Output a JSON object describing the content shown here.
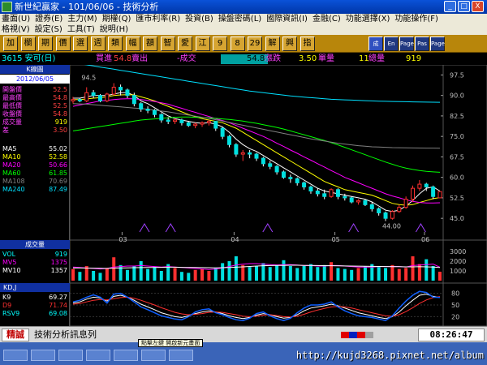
{
  "window": {
    "title": "新世紀贏家 - 101/06/06 - 技術分析",
    "min": "_",
    "max": "□",
    "close": "X"
  },
  "menu": {
    "row1": [
      "畫面(U)",
      "證券(E)",
      "主力(M)",
      "期權(Q)",
      "匯市利率(R)",
      "投資(B)",
      "操盤密碼(L)",
      "國際資訊(I)",
      "金融(C)",
      "功能選擇(X)",
      "功能操作(F)"
    ],
    "row2": [
      "格視(V)",
      "設定(S)",
      "工具(T)",
      "說明(H)"
    ]
  },
  "toolbar": {
    "buttons": [
      "加",
      "欄",
      "期",
      "價",
      "選",
      "週",
      "類",
      "幅",
      "額",
      "智",
      "愛",
      "江",
      "9",
      "8",
      "29",
      "解",
      "興",
      "指",
      "成",
      "En",
      "Page",
      "Pas",
      "Page"
    ]
  },
  "quote": {
    "code_label": "3615 安可(日)",
    "buy_label": "買進",
    "buy_value": "54.8",
    "sell_label": "賣出",
    "trade_label": "-成交",
    "trade_value": "54.8",
    "change_label": "漲跌",
    "change_value": "3.50",
    "unit_label": "單量",
    "unit_value": "11",
    "volume_label": "總量",
    "volume_value": "919"
  },
  "kline": {
    "title": "K線圖",
    "date": "2012/06/05",
    "stats": [
      {
        "label": "開盤價",
        "value": "52.5"
      },
      {
        "label": "最高價",
        "value": "54.8"
      },
      {
        "label": "最低價",
        "value": "52.5"
      },
      {
        "label": "收盤價",
        "value": "54.8"
      },
      {
        "label": "成交量",
        "value": "919"
      },
      {
        "label": "差",
        "value": "3.50"
      }
    ],
    "ma": [
      {
        "label": "MA5",
        "value": "55.02",
        "color": "#ffffff"
      },
      {
        "label": "MA10",
        "value": "52.58",
        "color": "#ffff00"
      },
      {
        "label": "MA20",
        "value": "50.66",
        "color": "#ff00ff"
      },
      {
        "label": "MA60",
        "value": "61.85",
        "color": "#00ff00"
      },
      {
        "label": "MA108",
        "value": "70.69",
        "color": "#808080"
      },
      {
        "label": "MA240",
        "value": "87.49",
        "color": "#00e0ff"
      }
    ]
  },
  "volume": {
    "title": "成交量",
    "items": [
      {
        "label": "VOL",
        "value": "919",
        "color": "#00ffff"
      },
      {
        "label": "MV5",
        "value": "1375",
        "color": "#ff00ff"
      },
      {
        "label": "MV10",
        "value": "1357",
        "color": "#ffffff"
      }
    ]
  },
  "kd": {
    "title": "KD,J",
    "items": [
      {
        "label": "K9",
        "value": "69.27",
        "color": "#ffffff"
      },
      {
        "label": "D9",
        "value": "71.74",
        "color": "#ff3030"
      },
      {
        "label": "RSV9",
        "value": "69.08",
        "color": "#00ffff"
      }
    ]
  },
  "status": {
    "brand": "精誠",
    "message": "技術分析訊息列",
    "clock": "08:26:47"
  },
  "taskbar": {
    "watermark": "http://kujd3268.pixnet.net/album",
    "tip": "點擊左鍵 開啟新元畫面"
  },
  "chart_data": [
    {
      "type": "candlestick",
      "y_ticks": [
        "97.5",
        "90.0",
        "82.5",
        "75.0",
        "67.5",
        "60.0",
        "52.5",
        "45.0"
      ],
      "x_labels": [
        "03",
        "04",
        "05",
        "06"
      ],
      "annotations": [
        "94.5",
        "44.00"
      ],
      "ohlc": [
        [
          88,
          89.5,
          87,
          88.5
        ],
        [
          88.5,
          89,
          87.5,
          88
        ],
        [
          88,
          93,
          87.5,
          91
        ],
        [
          91,
          92,
          89,
          90
        ],
        [
          90,
          90.5,
          87.5,
          88
        ],
        [
          88,
          91,
          87.5,
          90.5
        ],
        [
          90.5,
          94.5,
          90,
          93
        ],
        [
          93,
          94,
          90,
          92
        ],
        [
          92,
          92.5,
          89,
          90
        ],
        [
          90,
          91,
          86,
          87
        ],
        [
          87,
          87.5,
          84,
          85
        ],
        [
          85,
          86,
          83.5,
          84.5
        ],
        [
          84.5,
          85,
          82,
          83
        ],
        [
          83,
          83.5,
          80,
          81
        ],
        [
          81,
          82,
          79.5,
          80.5
        ],
        [
          80.5,
          81.5,
          79.5,
          81
        ],
        [
          81,
          81.5,
          79,
          80
        ],
        [
          80,
          80.5,
          78.5,
          79
        ],
        [
          79,
          80,
          78,
          79.5
        ],
        [
          79.5,
          80.5,
          78.5,
          80
        ],
        [
          80,
          81,
          79,
          80.5
        ],
        [
          80.5,
          80.5,
          77,
          78
        ],
        [
          78,
          78.5,
          74,
          75
        ],
        [
          75,
          75.5,
          71,
          72
        ],
        [
          72,
          72.5,
          67.5,
          68.5
        ],
        [
          68.5,
          70,
          66,
          69
        ],
        [
          69,
          70,
          67,
          68.5
        ],
        [
          68.5,
          69,
          66,
          67
        ],
        [
          67,
          67.5,
          64,
          65
        ],
        [
          65,
          66,
          63,
          64
        ],
        [
          64,
          64.5,
          61,
          62
        ],
        [
          62,
          62.5,
          59.5,
          60
        ],
        [
          60,
          61,
          58,
          59.5
        ],
        [
          59.5,
          60,
          57,
          58
        ],
        [
          58,
          58.5,
          55.5,
          56.5
        ],
        [
          56.5,
          57,
          54,
          55
        ],
        [
          55,
          56,
          53,
          54
        ],
        [
          54,
          55.5,
          52,
          53
        ],
        [
          53,
          56,
          52.5,
          55.5
        ],
        [
          55.5,
          56,
          52,
          53
        ],
        [
          53,
          54,
          51.5,
          52.5
        ],
        [
          52.5,
          53,
          50.5,
          51
        ],
        [
          51,
          52,
          50,
          51.5
        ],
        [
          51.5,
          52,
          49.5,
          50
        ],
        [
          50,
          51,
          47.5,
          48.5
        ],
        [
          48.5,
          49,
          46,
          47
        ],
        [
          47,
          47.5,
          44,
          45
        ],
        [
          45,
          48,
          44.5,
          47.5
        ],
        [
          47.5,
          50,
          47,
          49
        ],
        [
          49,
          53,
          48.5,
          52
        ],
        [
          52,
          57,
          51,
          56
        ],
        [
          56,
          59,
          55,
          57.5
        ],
        [
          57.5,
          58,
          55,
          56.5
        ],
        [
          56.5,
          57,
          52,
          53
        ],
        [
          52.5,
          54.8,
          52.5,
          54.8
        ]
      ],
      "ma": {
        "MA5": [
          89,
          89,
          89.5,
          90,
          90,
          90,
          90.5,
          91,
          91,
          90,
          88,
          87,
          85.5,
          84,
          82.5,
          81.5,
          81,
          80.5,
          80,
          79.8,
          80,
          79.5,
          78.5,
          76.5,
          74,
          72,
          70.5,
          69.5,
          68,
          66.5,
          65,
          63.5,
          62,
          60.5,
          59,
          57.5,
          56,
          55,
          54.5,
          54,
          53.5,
          53,
          52.5,
          52,
          51,
          49.5,
          48,
          47.5,
          48,
          49.5,
          51.5,
          54,
          56,
          56.5,
          55
        ],
        "MA10": [
          88.5,
          88.5,
          88.7,
          89,
          89.2,
          89.5,
          90,
          90.2,
          90.3,
          90.2,
          89.5,
          88.8,
          88,
          87,
          86,
          85,
          84,
          83,
          82.2,
          81.5,
          81,
          80.5,
          80,
          79,
          78,
          76.5,
          75,
          73.5,
          72,
          70.5,
          69,
          67.5,
          66,
          64.5,
          63,
          61.5,
          60,
          58.5,
          57.5,
          56.5,
          55.5,
          55,
          54.5,
          54,
          53.5,
          52.5,
          51.5,
          50.5,
          50,
          49.8,
          50,
          50.8,
          51.5,
          52.2,
          52.6
        ],
        "MA20": [
          86,
          86.5,
          87,
          87.5,
          88,
          88.2,
          88.5,
          88.7,
          88.8,
          88.8,
          88.5,
          88.2,
          87.8,
          87.3,
          86.8,
          86,
          85.3,
          84.5,
          83.8,
          83,
          82.3,
          81.5,
          80.8,
          80,
          79,
          78,
          77,
          76,
          75,
          73.8,
          72.5,
          71.3,
          70,
          68.8,
          67.5,
          66.3,
          65,
          63.8,
          62.5,
          61.3,
          60,
          59,
          58,
          57,
          56,
          55,
          54,
          53.2,
          52.5,
          51.8,
          51.2,
          50.8,
          50.6,
          50.6,
          50.7
        ],
        "MA60": [
          77,
          77.4,
          77.8,
          78.2,
          78.6,
          79,
          79.4,
          79.8,
          80.2,
          80.6,
          81,
          81.2,
          81.4,
          81.6,
          81.8,
          82,
          82.1,
          82.1,
          82,
          81.9,
          81.8,
          81.6,
          81.4,
          81.2,
          80.9,
          80.6,
          80.2,
          79.8,
          79.3,
          78.8,
          78.3,
          77.7,
          77,
          76.3,
          75.6,
          74.9,
          74.2,
          73.5,
          72.7,
          71.9,
          71,
          70.1,
          69.2,
          68.3,
          67.4,
          66.5,
          65.6,
          64.8,
          64,
          63.4,
          62.9,
          62.5,
          62.2,
          62,
          61.85
        ],
        "MA108": [
          87,
          86.9,
          86.8,
          86.6,
          86.4,
          86.2,
          86,
          85.8,
          85.6,
          85.4,
          85.2,
          84.9,
          84.6,
          84.3,
          84,
          83.6,
          83.2,
          82.8,
          82.4,
          82,
          81.6,
          81.1,
          80.6,
          80.1,
          79.6,
          79.1,
          78.6,
          78.1,
          77.6,
          77.1,
          76.6,
          76.1,
          75.6,
          75.1,
          74.6,
          74.1,
          73.7,
          73.3,
          72.9,
          72.5,
          72.2,
          71.9,
          71.6,
          71.4,
          71.2,
          71.1,
          71,
          70.9,
          70.85,
          70.8,
          70.76,
          70.73,
          70.71,
          70.7,
          70.69
        ],
        "MA240": [
          102,
          101.6,
          101.2,
          100.8,
          100.4,
          100,
          99.6,
          99.2,
          98.8,
          98.4,
          98,
          97.6,
          97.2,
          96.8,
          96.4,
          96,
          95.6,
          95.2,
          94.8,
          94.4,
          94,
          93.6,
          93.2,
          92.8,
          92.4,
          92,
          91.6,
          91.3,
          91,
          90.7,
          90.4,
          90.1,
          89.8,
          89.6,
          89.4,
          89.2,
          89,
          88.8,
          88.6,
          88.5,
          88.4,
          88.3,
          88.2,
          88.1,
          88,
          87.9,
          87.85,
          87.8,
          87.75,
          87.7,
          87.65,
          87.6,
          87.55,
          87.52,
          87.49
        ]
      }
    },
    {
      "type": "bar",
      "y_ticks": [
        "3000",
        "2000",
        "1000"
      ],
      "values": [
        1200,
        900,
        1500,
        1000,
        800,
        1300,
        2400,
        1600,
        1100,
        1500,
        2000,
        1200,
        1400,
        1000,
        1700,
        1300,
        900,
        800,
        1100,
        1200,
        1000,
        1300,
        1800,
        2000,
        2500,
        1600,
        1400,
        1500,
        1800,
        1400,
        1600,
        2100,
        1500,
        1300,
        1500,
        1700,
        1400,
        1600,
        1900,
        1300,
        1200,
        1100,
        1300,
        1500,
        1700,
        1400,
        1300,
        1600,
        1200,
        1300,
        2500,
        1700,
        2200,
        1500,
        919
      ],
      "mv5": [
        1400,
        1350,
        1300,
        1250,
        1200,
        1250,
        1400,
        1450,
        1500,
        1500,
        1550,
        1500,
        1450,
        1400,
        1450,
        1400,
        1350,
        1300,
        1250,
        1200,
        1150,
        1200,
        1300,
        1450,
        1600,
        1700,
        1750,
        1750,
        1700,
        1650,
        1600,
        1650,
        1650,
        1600,
        1550,
        1550,
        1500,
        1500,
        1550,
        1550,
        1500,
        1450,
        1400,
        1400,
        1400,
        1450,
        1450,
        1450,
        1450,
        1400,
        1550,
        1600,
        1650,
        1700,
        1375
      ],
      "mv10": [
        1300,
        1300,
        1290,
        1280,
        1270,
        1260,
        1280,
        1300,
        1320,
        1330,
        1340,
        1350,
        1360,
        1370,
        1380,
        1380,
        1370,
        1360,
        1350,
        1340,
        1330,
        1320,
        1330,
        1350,
        1380,
        1420,
        1460,
        1500,
        1530,
        1550,
        1560,
        1570,
        1580,
        1580,
        1570,
        1560,
        1550,
        1540,
        1530,
        1520,
        1510,
        1500,
        1490,
        1480,
        1470,
        1460,
        1450,
        1440,
        1430,
        1420,
        1420,
        1430,
        1420,
        1400,
        1357
      ]
    },
    {
      "type": "line",
      "y_ticks": [
        "80",
        "50",
        "20"
      ],
      "series": [
        {
          "name": "K9",
          "values": [
            55,
            58,
            65,
            70,
            68,
            60,
            72,
            75,
            70,
            62,
            52,
            45,
            38,
            30,
            25,
            20,
            18,
            22,
            28,
            32,
            35,
            32,
            28,
            22,
            18,
            15,
            18,
            24,
            28,
            25,
            20,
            16,
            18,
            25,
            35,
            42,
            45,
            48,
            52,
            48,
            42,
            36,
            30,
            26,
            22,
            18,
            15,
            20,
            32,
            48,
            62,
            75,
            78,
            72,
            69.27
          ]
        },
        {
          "name": "D9",
          "values": [
            52,
            54,
            58,
            62,
            64,
            63,
            66,
            69,
            70,
            67,
            62,
            56,
            50,
            43,
            37,
            31,
            27,
            25,
            26,
            28,
            31,
            32,
            31,
            28,
            25,
            21,
            20,
            21,
            24,
            25,
            23,
            20,
            19,
            21,
            26,
            32,
            37,
            41,
            45,
            46,
            45,
            42,
            38,
            34,
            30,
            26,
            22,
            21,
            25,
            33,
            43,
            54,
            63,
            69,
            71.74
          ]
        },
        {
          "name": "RSV9",
          "values": [
            58,
            62,
            70,
            76,
            70,
            55,
            78,
            80,
            70,
            58,
            45,
            38,
            30,
            22,
            18,
            14,
            12,
            20,
            32,
            38,
            40,
            30,
            25,
            18,
            12,
            10,
            16,
            28,
            32,
            22,
            15,
            10,
            16,
            30,
            42,
            50,
            50,
            52,
            58,
            45,
            35,
            28,
            22,
            20,
            18,
            14,
            10,
            22,
            42,
            60,
            75,
            85,
            82,
            70,
            69.08
          ]
        }
      ]
    }
  ]
}
